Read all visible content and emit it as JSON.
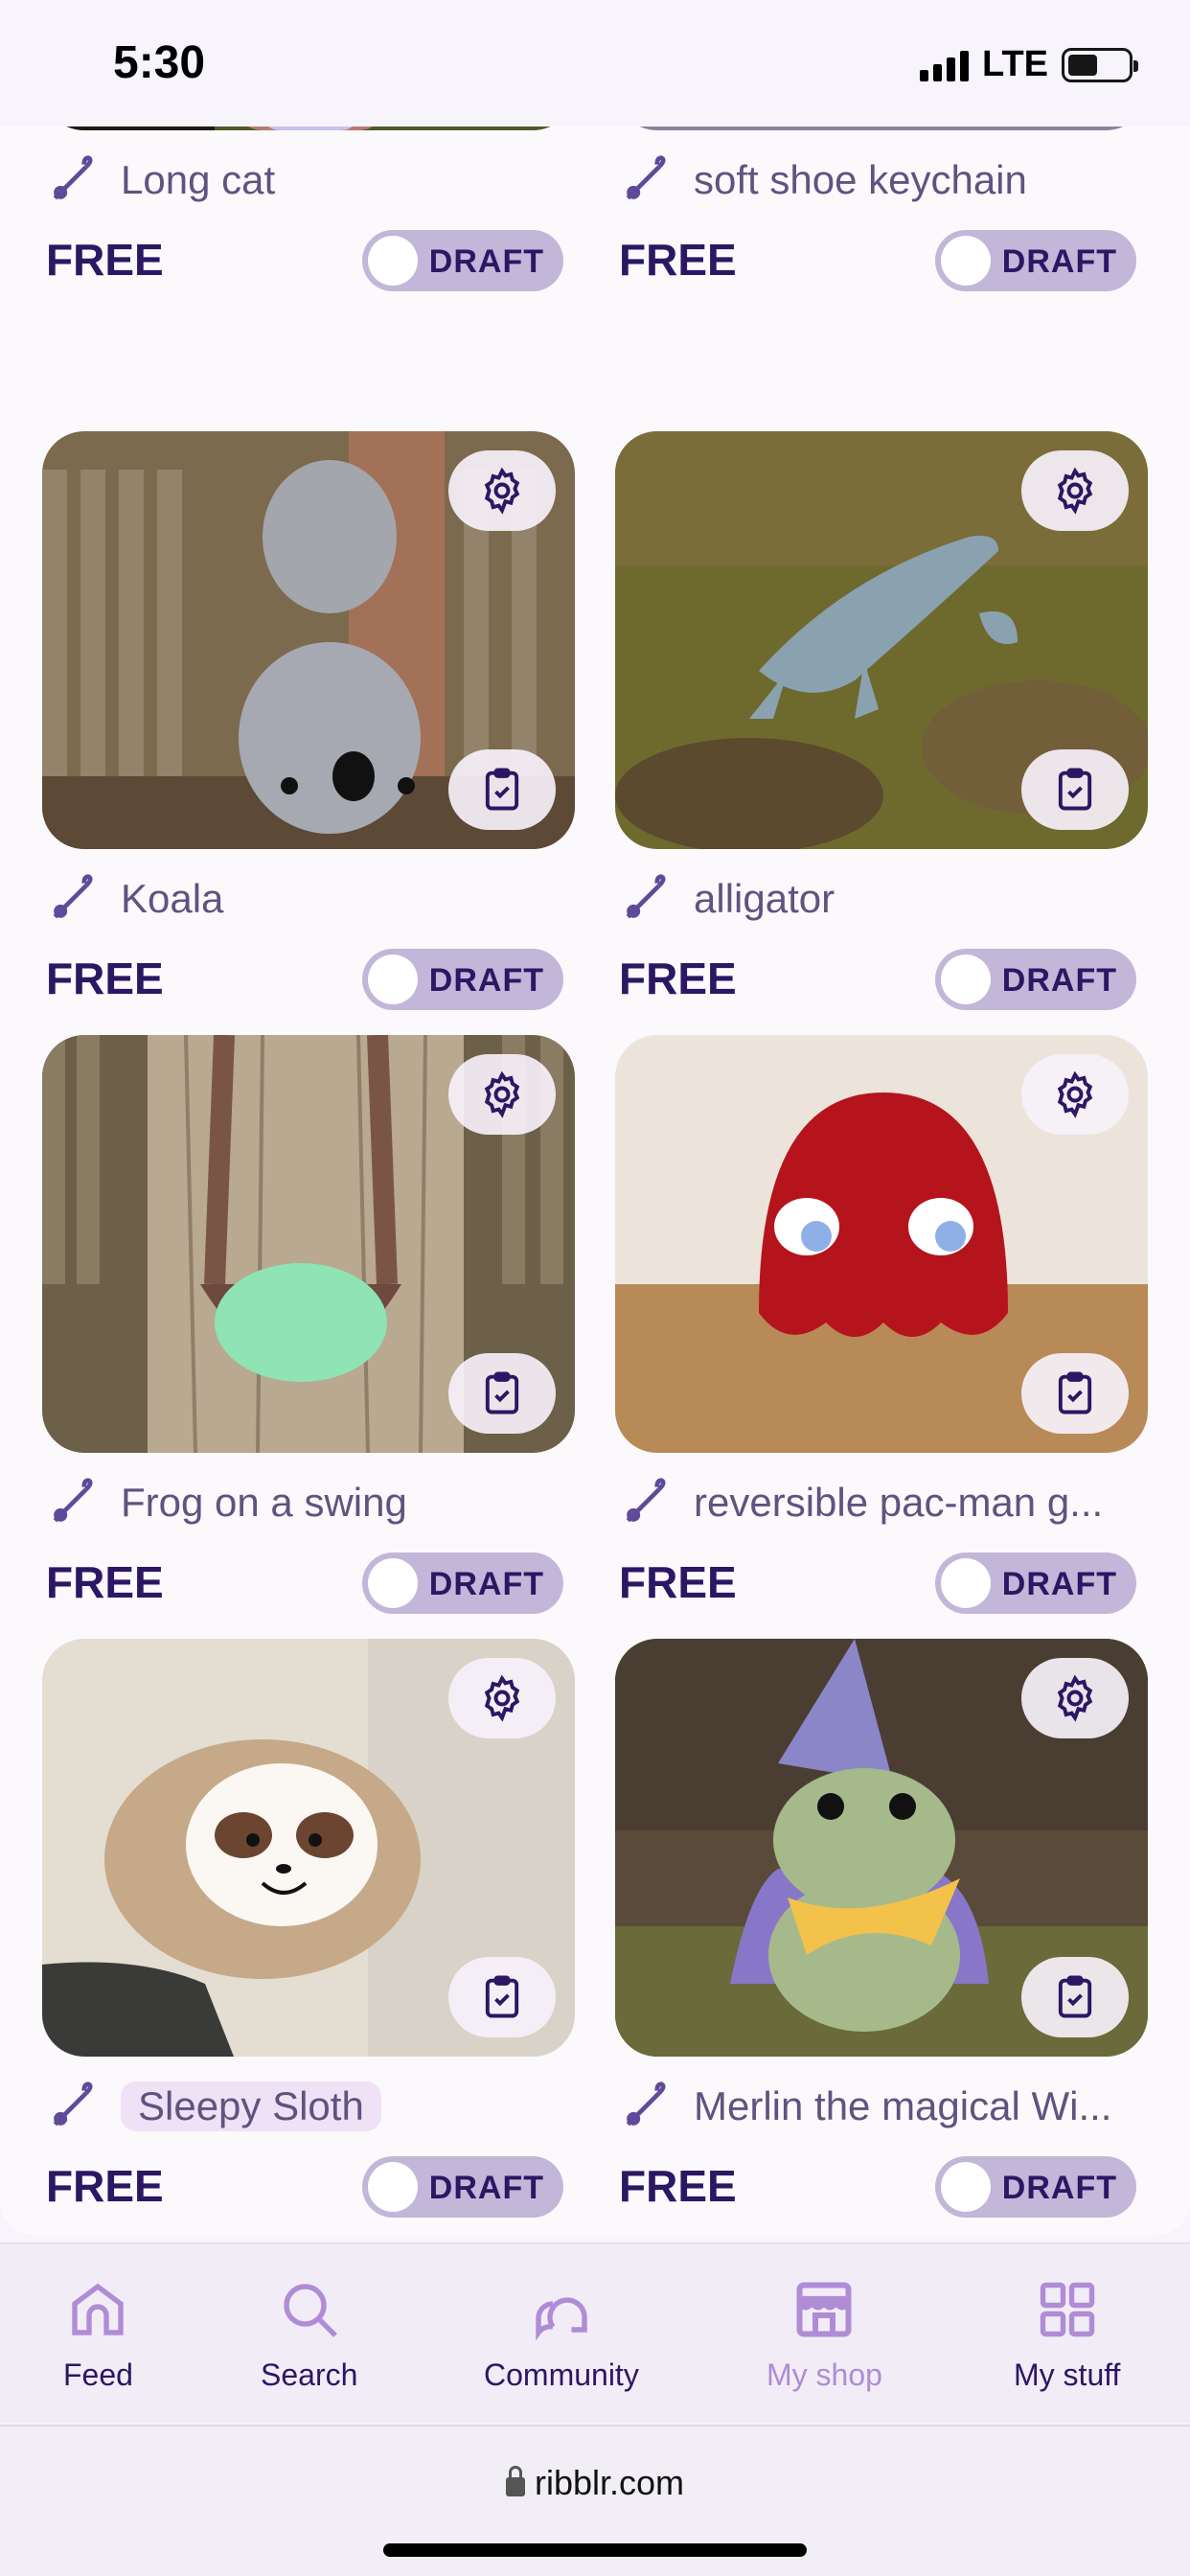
{
  "status": {
    "time": "5:30",
    "network": "LTE"
  },
  "cards": [
    {
      "title": "Long cat",
      "price": "FREE",
      "draft": "DRAFT",
      "highlight": false
    },
    {
      "title": "soft shoe keychain",
      "price": "FREE",
      "draft": "DRAFT",
      "highlight": false
    },
    {
      "title": "Koala",
      "price": "FREE",
      "draft": "DRAFT",
      "highlight": false
    },
    {
      "title": "alligator",
      "price": "FREE",
      "draft": "DRAFT",
      "highlight": false
    },
    {
      "title": "Frog on a swing",
      "price": "FREE",
      "draft": "DRAFT",
      "highlight": false
    },
    {
      "title": "reversible pac-man g...",
      "price": "FREE",
      "draft": "DRAFT",
      "highlight": false
    },
    {
      "title": "Sleepy Sloth",
      "price": "FREE",
      "draft": "DRAFT",
      "highlight": true
    },
    {
      "title": "Merlin the magical Wi...",
      "price": "FREE",
      "draft": "DRAFT",
      "highlight": false
    }
  ],
  "nav": [
    {
      "label": "Feed",
      "icon": "home-icon"
    },
    {
      "label": "Search",
      "icon": "search-icon"
    },
    {
      "label": "Community",
      "icon": "chat-icon"
    },
    {
      "label": "My shop",
      "icon": "shop-icon",
      "active": true
    },
    {
      "label": "My stuff",
      "icon": "grid-icon"
    }
  ],
  "browser": {
    "url": "ribblr.com"
  },
  "colors": {
    "accent": "#b08cd6",
    "text_dark": "#2b1763",
    "pill": "#c2b6d9"
  }
}
